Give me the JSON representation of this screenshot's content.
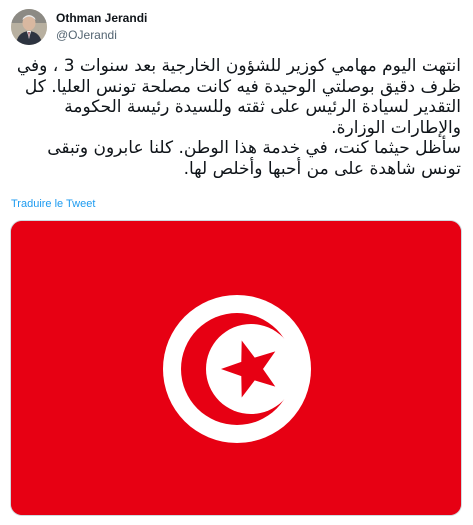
{
  "author": {
    "name": "Othman Jerandi",
    "handle": "@OJerandi"
  },
  "tweet": {
    "paragraph_1": "انتهت اليوم مهامي كوزير للشؤون الخارجية بعد سنوات 3 ، وفي ظرف دقيق بوصلتي الوحيدة فيه كانت مصلحة تونس العليا. كل التقدير لسيادة الرئيس على ثقته وللسيدة رئيسة الحكومة والإطارات الوزارة.",
    "paragraph_2": "سأظل حيثما كنت، في خدمة هذا الوطن. كلنا عابرون وتبقى تونس شاهدة على من أحبها وأخلص لها.",
    "translate_label": "Traduire le Tweet"
  },
  "media": {
    "image_name": "tunisia-flag",
    "flag_red": "#e70013",
    "flag_white": "#ffffff"
  },
  "colors": {
    "link": "#1d9bf0",
    "text": "#0f1419",
    "secondary": "#536471"
  }
}
